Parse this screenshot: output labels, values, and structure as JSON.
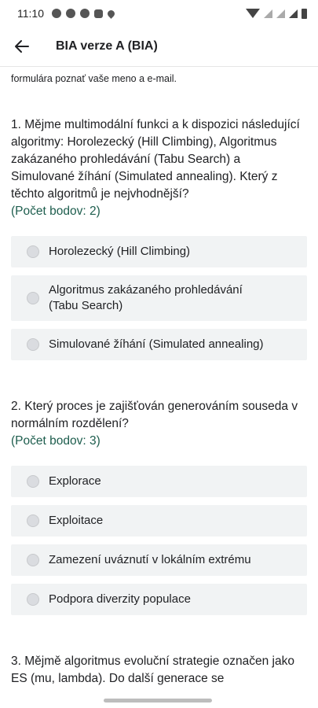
{
  "status_bar": {
    "time": "11:10",
    "notification_icons": [
      "messenger-icon",
      "messenger-icon",
      "messenger-icon",
      "instagram-icon",
      "location-icon"
    ],
    "system_icons": [
      "wifi-icon",
      "signal-icon",
      "signal-r-icon",
      "signal-icon",
      "battery-icon"
    ]
  },
  "app_bar": {
    "title": "BIA verze A (BIA)",
    "back_icon": "arrow-left-icon"
  },
  "intro_text": "formulára poznať vaše meno a e-mail.",
  "questions": [
    {
      "text": "1. Mějme multimodální funkci a k dispozici následující algoritmy: Horolezecký (Hill Climbing), Algoritmus zakázaného prohledávání (Tabu Search) a Simulované žíhání (Simulated annealing). Který z těchto algoritmů je nejvhodnější?",
      "points": "(Počet bodov: 2)",
      "options": [
        "Horolezecký (Hill Climbing)",
        "Algoritmus zakázaného prohledávání (Tabu Search)",
        "Simulované žíhání (Simulated annealing)"
      ]
    },
    {
      "text": "2. Který proces je zajišťován generováním souseda v normálním rozdělení?",
      "points": "(Počet bodov: 3)",
      "options": [
        "Explorace",
        "Exploitace",
        "Zamezení uváznutí v lokálním extrému",
        "Podpora diverzity populace"
      ]
    },
    {
      "text": "3. Mějmě algoritmus evoluční strategie označen jako ES (mu, lambda). Do další generace se"
    }
  ]
}
